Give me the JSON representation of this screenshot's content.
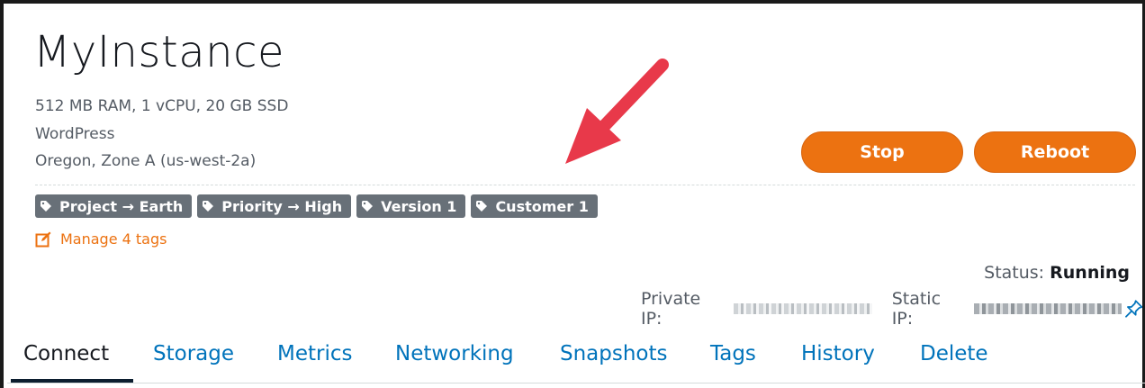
{
  "instance": {
    "name": "MyInstance",
    "specs": "512 MB RAM, 1 vCPU, 20 GB SSD",
    "blueprint": "WordPress",
    "location": "Oregon, Zone A (us-west-2a)"
  },
  "buttons": {
    "stop": "Stop",
    "reboot": "Reboot"
  },
  "tags": [
    {
      "label": "Project → Earth"
    },
    {
      "label": "Priority → High"
    },
    {
      "label": "Version 1"
    },
    {
      "label": "Customer 1"
    }
  ],
  "manage_tags": "Manage 4 tags",
  "status": {
    "label": "Status:",
    "value": "Running"
  },
  "network": {
    "private_ip_label": "Private IP:",
    "static_ip_label": "Static IP:"
  },
  "tabs": [
    {
      "label": "Connect",
      "active": true
    },
    {
      "label": "Storage"
    },
    {
      "label": "Metrics"
    },
    {
      "label": "Networking"
    },
    {
      "label": "Snapshots"
    },
    {
      "label": "Tags"
    },
    {
      "label": "History"
    },
    {
      "label": "Delete"
    }
  ],
  "colors": {
    "accent": "#ec7211",
    "link": "#0073bb",
    "tag_bg": "#687078",
    "annotation_arrow": "#e8394a"
  },
  "icons": [
    "tag-icon",
    "edit-icon",
    "pin-icon",
    "annotation-arrow"
  ]
}
